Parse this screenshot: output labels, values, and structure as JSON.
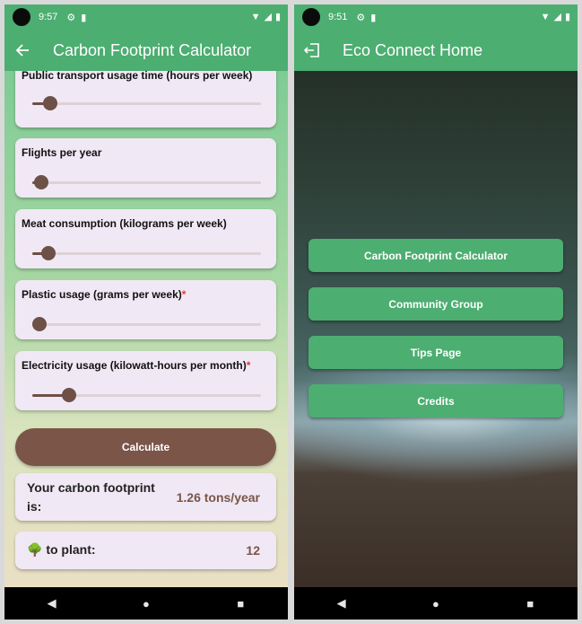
{
  "colors": {
    "app_bar": "#4cae71",
    "slider_active": "#6d5046",
    "calculate_button": "#7a5548",
    "card_background": "#f0e8f4",
    "required_asterisk": "#e53935",
    "home_button": "#4cae71"
  },
  "left_screen": {
    "status_bar": {
      "time": "9:57",
      "icons": [
        "settings-icon",
        "sim-card-icon",
        "wifi-icon",
        "signal-icon",
        "battery-icon"
      ]
    },
    "app_bar": {
      "title": "Carbon Footprint Calculator",
      "nav_icon": "back-arrow-icon"
    },
    "inputs": [
      {
        "label": "Public transport usage time (hours per week)",
        "required": false,
        "value_fraction": 0.08
      },
      {
        "label": "Flights per year",
        "required": false,
        "value_fraction": 0.04
      },
      {
        "label": "Meat consumption (kilograms per week)",
        "required": false,
        "value_fraction": 0.07
      },
      {
        "label": "Plastic usage (grams per week)",
        "required": true,
        "value_fraction": 0.03
      },
      {
        "label": "Electricity usage (kilowatt-hours per month)",
        "required": true,
        "value_fraction": 0.16
      }
    ],
    "required_marker": "*",
    "calculate_label": "Calculate",
    "results": {
      "footprint_label": "Your carbon footprint is:",
      "footprint_value": "1.26 tons/year",
      "trees_icon": "tree-icon",
      "trees_label": "to plant:",
      "trees_value": "12"
    }
  },
  "right_screen": {
    "status_bar": {
      "time": "9:51",
      "icons": [
        "settings-icon",
        "sim-card-icon",
        "wifi-icon",
        "signal-icon",
        "battery-icon"
      ]
    },
    "app_bar": {
      "title": "Eco Connect Home",
      "nav_icon": "logout-icon"
    },
    "buttons": [
      {
        "label": "Carbon Footprint Calculator"
      },
      {
        "label": "Community Group"
      },
      {
        "label": "Tips Page"
      },
      {
        "label": "Credits"
      }
    ]
  },
  "system_nav": [
    "back-icon",
    "home-icon",
    "recents-icon"
  ]
}
